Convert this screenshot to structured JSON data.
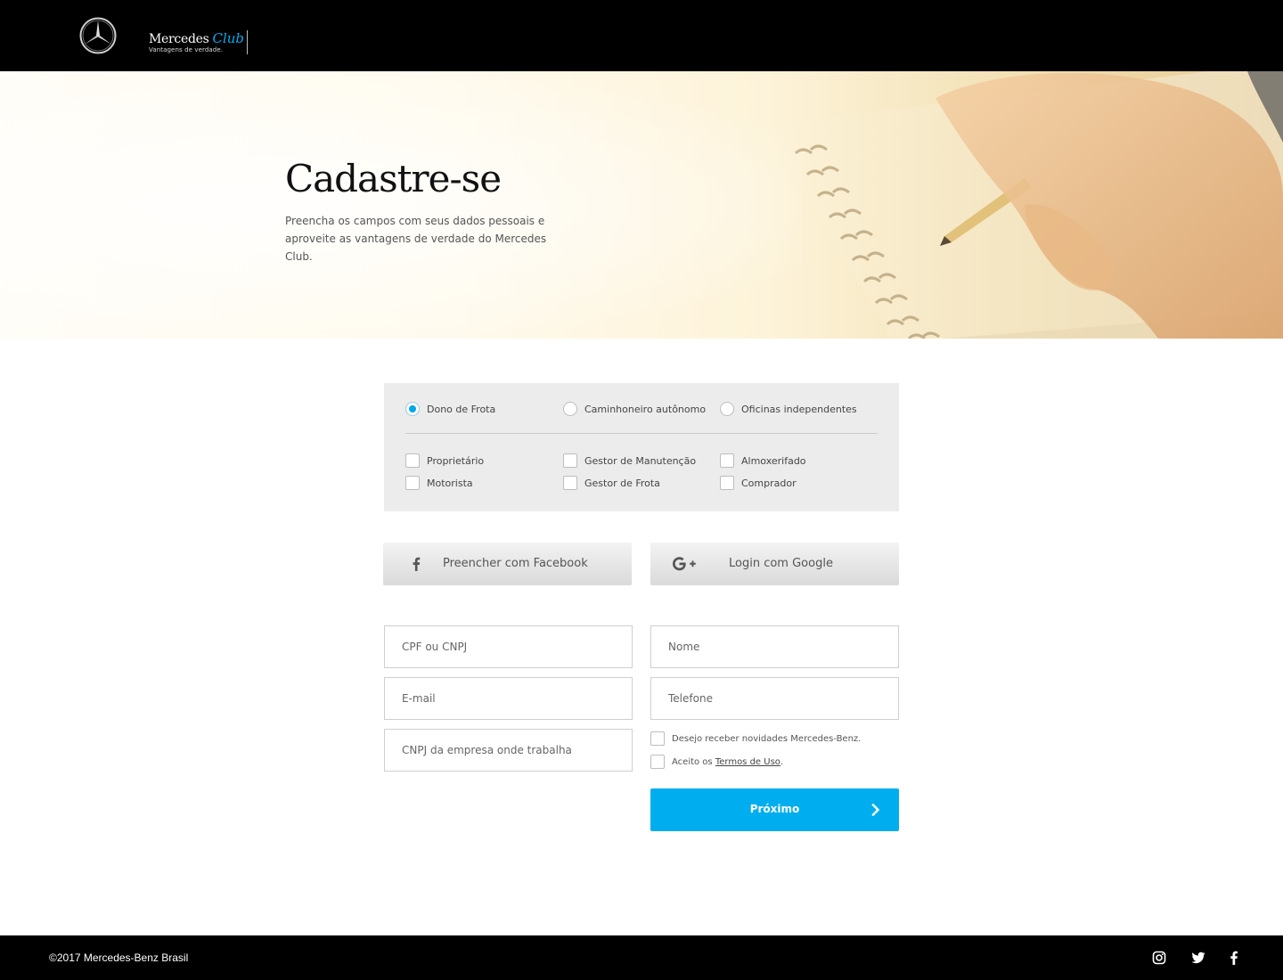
{
  "header": {
    "brand_name": "Mercedes",
    "brand_club": "Club",
    "brand_tagline": "Vantagens de verdade."
  },
  "hero": {
    "title": "Cadastre-se",
    "subtitle_line1": "Preencha os campos com seus dados pessoais e",
    "subtitle_line2": "aproveite as vantagens de verdade do Mercedes Club."
  },
  "profile": {
    "types": [
      {
        "label": "Dono de Frota",
        "selected": true
      },
      {
        "label": "Caminhoneiro autônomo",
        "selected": false
      },
      {
        "label": "Oficinas independentes",
        "selected": false
      }
    ],
    "roles": [
      {
        "label": "Proprietário",
        "checked": false
      },
      {
        "label": "Gestor de Manutenção",
        "checked": false
      },
      {
        "label": "Almoxerifado",
        "checked": false
      },
      {
        "label": "Motorista",
        "checked": false
      },
      {
        "label": "Gestor de Frota",
        "checked": false
      },
      {
        "label": "Comprador",
        "checked": false
      }
    ]
  },
  "social": {
    "facebook_label": "Preencher com Facebook",
    "google_label": "Login com Google"
  },
  "form": {
    "cpf_placeholder": "CPF ou CNPJ",
    "cpf_value": "",
    "nome_placeholder": "Nome",
    "nome_value": "",
    "email_placeholder": "E-mail",
    "email_value": "",
    "telefone_placeholder": "Telefone",
    "telefone_value": "",
    "cnpj_empresa_placeholder": "CNPJ da empresa onde trabalha",
    "cnpj_empresa_value": "",
    "newsletter_label": "Desejo receber novidades Mercedes-Benz.",
    "newsletter_checked": false,
    "terms_prefix": "Aceito os ",
    "terms_link": "Termos de Uso",
    "terms_suffix": ".",
    "terms_checked": false,
    "next_label": "Próximo"
  },
  "footer": {
    "copyright": "©2017 Mercedes-Benz Brasil"
  },
  "colors": {
    "accent": "#00aeef",
    "header_bg": "#000000",
    "panel_bg": "#ececec"
  },
  "icons": [
    "mercedes-star-icon",
    "facebook-icon",
    "google-plus-icon",
    "chevron-right-icon",
    "instagram-icon",
    "twitter-icon"
  ]
}
